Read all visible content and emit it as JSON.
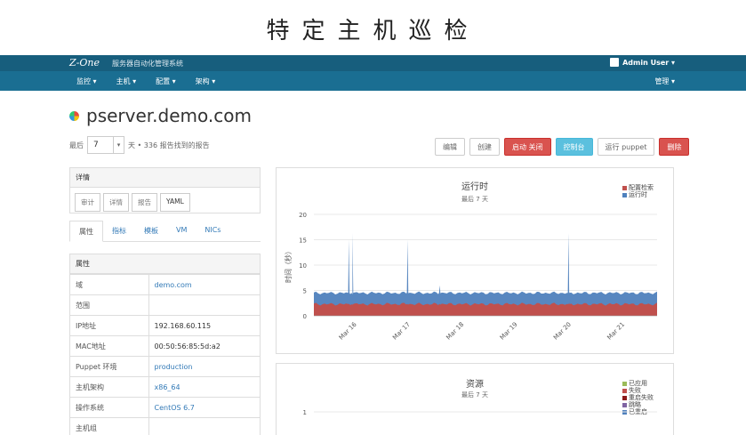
{
  "slide_title": "特定主机巡检",
  "topbar": {
    "logo": "Z-One",
    "app_name": "服务器自动化管理系统",
    "user": "Admin User ▾"
  },
  "navbar": {
    "items": [
      "监控 ▾",
      "主机 ▾",
      "配置 ▾",
      "架构 ▾"
    ],
    "right": "管理 ▾"
  },
  "host": {
    "name": "pserver.demo.com"
  },
  "period": {
    "prefix": "最后",
    "value": "7",
    "caret": "▾",
    "suffix": "天 • 336 报告找到的报告"
  },
  "actions": [
    {
      "label": "编辑",
      "style": "default"
    },
    {
      "label": "创建",
      "style": "default"
    },
    {
      "label": "启动 关闭",
      "style": "red"
    },
    {
      "label": "控制台",
      "style": "cyan"
    },
    {
      "label": "运行 puppet",
      "style": "default"
    },
    {
      "label": "删除",
      "style": "red"
    }
  ],
  "details": {
    "title": "详情",
    "buttons": [
      "审计",
      "详情",
      "报告",
      "YAML"
    ]
  },
  "tabs": [
    "属性",
    "指标",
    "模板",
    "VM",
    "NICs"
  ],
  "properties": {
    "title": "属性",
    "rows": [
      {
        "key": "域",
        "value": "demo.com",
        "link": true
      },
      {
        "key": "范围",
        "value": "",
        "link": false
      },
      {
        "key": "IP地址",
        "value": "192.168.60.115",
        "link": false
      },
      {
        "key": "MAC地址",
        "value": "00:50:56:85:5d:a2",
        "link": false
      },
      {
        "key": "Puppet 环境",
        "value": "production",
        "link": true
      },
      {
        "key": "主机架构",
        "value": "x86_64",
        "link": true
      },
      {
        "key": "操作系统",
        "value": "CentOS 6.7",
        "link": true
      },
      {
        "key": "主机组",
        "value": "",
        "link": false
      }
    ]
  },
  "chart_data": [
    {
      "type": "area",
      "title": "运行时",
      "subtitle": "最后 7 天",
      "ylabel": "时间（秒）",
      "ylim": [
        0,
        20
      ],
      "yticks": [
        0,
        5,
        10,
        15,
        20
      ],
      "xticks": [
        "Mar 16",
        "Mar 17",
        "Mar 18",
        "Mar 19",
        "Mar 20",
        "Mar 21"
      ],
      "x_range": [
        15.2,
        21.6
      ],
      "series": [
        {
          "name": "配置检索",
          "color": "#c0504d",
          "baseline": 2.3
        },
        {
          "name": "运行时",
          "color": "#4f81bd",
          "baseline": 4.5
        }
      ],
      "spikes": [
        {
          "x": 15.85,
          "value": 15.0
        },
        {
          "x": 15.92,
          "value": 16.3
        },
        {
          "x": 16.95,
          "value": 15.0
        },
        {
          "x": 17.55,
          "value": 6.0
        },
        {
          "x": 19.95,
          "value": 16.3
        }
      ],
      "legend": "top-right"
    },
    {
      "type": "area",
      "title": "资源",
      "subtitle": "最后 7 天",
      "yticks": [
        1
      ],
      "series": [
        {
          "name": "已应用",
          "color": "#9bbb59"
        },
        {
          "name": "失败",
          "color": "#c0504d"
        },
        {
          "name": "重启失败",
          "color": "#8b1a1a"
        },
        {
          "name": "跳略",
          "color": "#8064a2"
        },
        {
          "name": "已重启",
          "color": "#4f81bd"
        }
      ],
      "legend": "top-right"
    }
  ]
}
